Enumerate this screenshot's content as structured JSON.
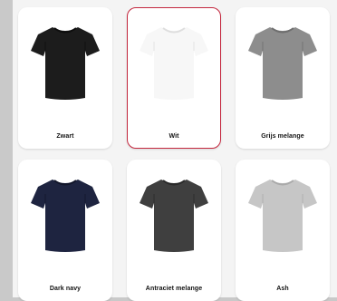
{
  "colors": {
    "selected_border": "#c4283f"
  },
  "swatches": [
    {
      "label": "Zwart",
      "shirt_color": "#1c1c1c",
      "shade_color": "#0e0e0e",
      "selected": false
    },
    {
      "label": "Wit",
      "shirt_color": "#f7f7f7",
      "shade_color": "#dedede",
      "selected": true
    },
    {
      "label": "Grijs melange",
      "shirt_color": "#8d8d8d",
      "shade_color": "#6e6e6e",
      "selected": false
    },
    {
      "label": "Dark navy",
      "shirt_color": "#1e2440",
      "shade_color": "#12162a",
      "selected": false
    },
    {
      "label": "Antraciet melange",
      "shirt_color": "#3f3f3f",
      "shade_color": "#2a2a2a",
      "selected": false
    },
    {
      "label": "Ash",
      "shirt_color": "#c6c6c6",
      "shade_color": "#aaaaaa",
      "selected": false
    }
  ]
}
